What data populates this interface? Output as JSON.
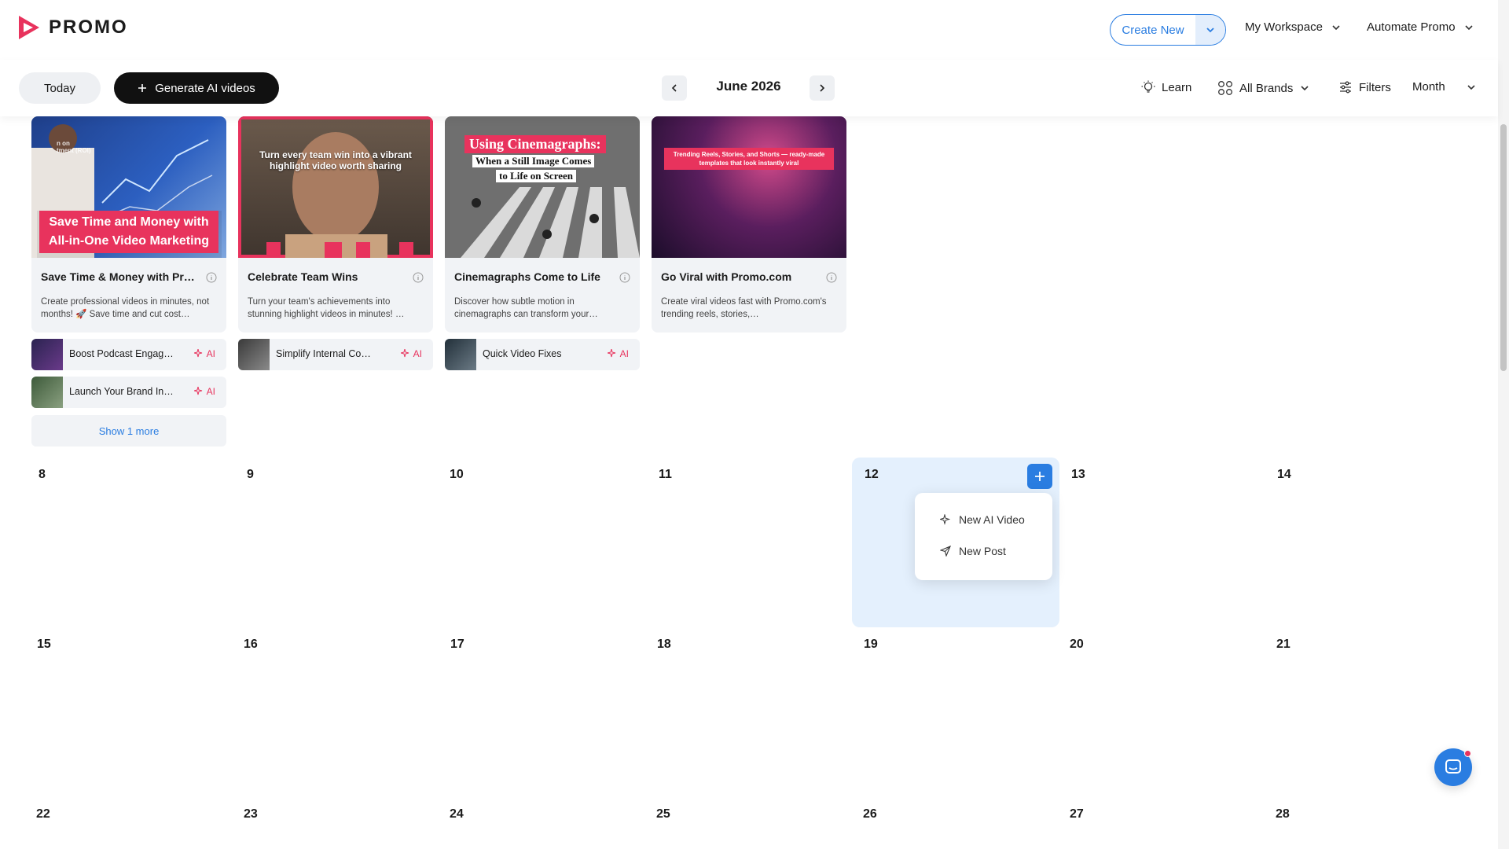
{
  "header": {
    "logo_text": "PROMO",
    "create_new": "Create New",
    "workspace": "My Workspace",
    "automate": "Automate Promo"
  },
  "toolbar": {
    "today": "Today",
    "generate": "Generate AI videos",
    "month_title": "June 2026",
    "learn": "Learn",
    "brands": "All Brands",
    "filters": "Filters",
    "view": "Month"
  },
  "cards": [
    {
      "title": "Save Time & Money with Pr…",
      "desc": "Create professional videos in minutes, not months! 🚀 Save time and cut cost…",
      "caption1": "Save Time and Money with",
      "caption2": "All-in-One Video Marketing",
      "chart_caption1": "n on",
      "chart_caption2": "tment (ROI)"
    },
    {
      "title": "Celebrate Team Wins",
      "desc": "Turn your team's achievements into stunning highlight videos in minutes! …",
      "caption1": "Turn every team win into a vibrant",
      "caption2": "highlight video worth sharing"
    },
    {
      "title": "Cinemagraphs Come to Life",
      "desc": "Discover how subtle motion in cinemagraphs can transform your…",
      "caption1": "Using Cinemagraphs:",
      "caption2": "When a Still Image Comes",
      "caption3": "to Life on Screen"
    },
    {
      "title": "Go Viral with Promo.com",
      "desc": "Create viral videos fast with Promo.com's trending reels, stories,…",
      "caption1": "Trending Reels, Stories, and Shorts — ready-made",
      "caption2": "templates that look instantly viral"
    }
  ],
  "minis": [
    {
      "title": "Boost Podcast Engag…",
      "tag": "AI"
    },
    {
      "title": "Simplify Internal Co…",
      "tag": "AI"
    },
    {
      "title": "Quick Video Fixes",
      "tag": "AI"
    },
    {
      "title": "Launch Your Brand In…",
      "tag": "AI"
    }
  ],
  "show_more": "Show 1 more",
  "days": [
    "8",
    "9",
    "10",
    "11",
    "12",
    "13",
    "14",
    "15",
    "16",
    "17",
    "18",
    "19",
    "20",
    "21",
    "22",
    "23",
    "24",
    "25",
    "26",
    "27",
    "28"
  ],
  "popup": {
    "new_ai_video": "New AI Video",
    "new_post": "New Post"
  },
  "colors": {
    "accent": "#2a7de1",
    "brand_red": "#e8335d",
    "highlight_cell": "#e4f0fd"
  }
}
